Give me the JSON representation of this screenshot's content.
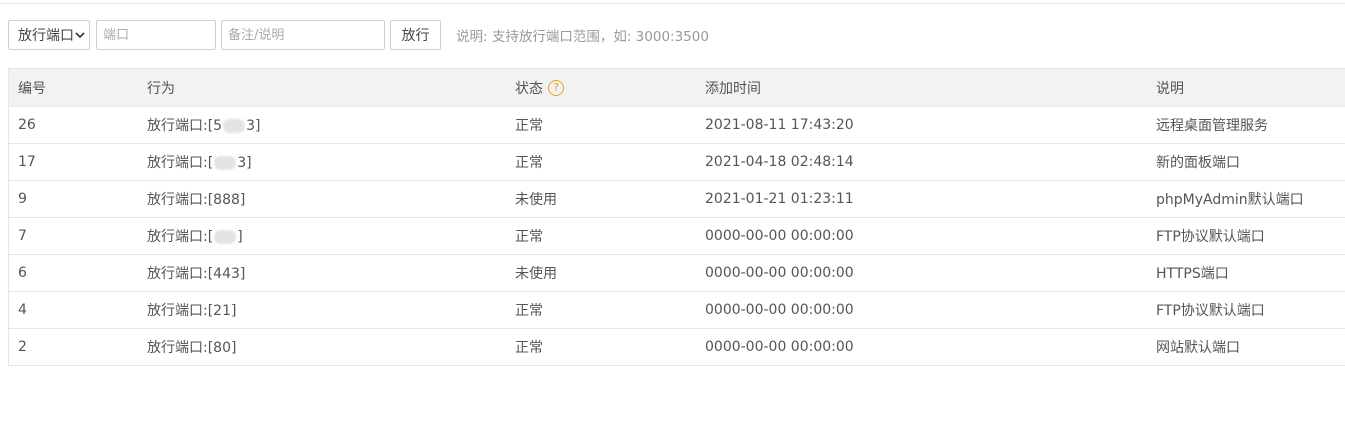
{
  "toolbar": {
    "select_value": "放行端口",
    "port_placeholder": "端口",
    "note_placeholder": "备注/说明",
    "submit_label": "放行",
    "hint": "说明: 支持放行端口范围，如: 3000:3500"
  },
  "table": {
    "headers": {
      "id": "编号",
      "action": "行为",
      "status": "状态",
      "help": "?",
      "time": "添加时间",
      "desc": "说明"
    },
    "rows": [
      {
        "id": "26",
        "action_prefix": "放行端口:[5",
        "action_suffix": "3]",
        "redacted": true,
        "status": "正常",
        "time": "2021-08-11 17:43:20",
        "desc": "远程桌面管理服务"
      },
      {
        "id": "17",
        "action_prefix": "放行端口:[",
        "action_suffix": "3]",
        "redacted": true,
        "status": "正常",
        "time": "2021-04-18 02:48:14",
        "desc": "新的面板端口"
      },
      {
        "id": "9",
        "action_prefix": "放行端口:[888]",
        "action_suffix": "",
        "redacted": false,
        "status": "未使用",
        "time": "2021-01-21 01:23:11",
        "desc": "phpMyAdmin默认端口"
      },
      {
        "id": "7",
        "action_prefix": "放行端口:[",
        "action_suffix": "]",
        "redacted": true,
        "status": "正常",
        "time": "0000-00-00 00:00:00",
        "desc": "FTP协议默认端口"
      },
      {
        "id": "6",
        "action_prefix": "放行端口:[443]",
        "action_suffix": "",
        "redacted": false,
        "status": "未使用",
        "time": "0000-00-00 00:00:00",
        "desc": "HTTPS端口"
      },
      {
        "id": "4",
        "action_prefix": "放行端口:[21]",
        "action_suffix": "",
        "redacted": false,
        "status": "正常",
        "time": "0000-00-00 00:00:00",
        "desc": "FTP协议默认端口"
      },
      {
        "id": "2",
        "action_prefix": "放行端口:[80]",
        "action_suffix": "",
        "redacted": false,
        "status": "正常",
        "time": "0000-00-00 00:00:00",
        "desc": "网站默认端口"
      }
    ]
  }
}
